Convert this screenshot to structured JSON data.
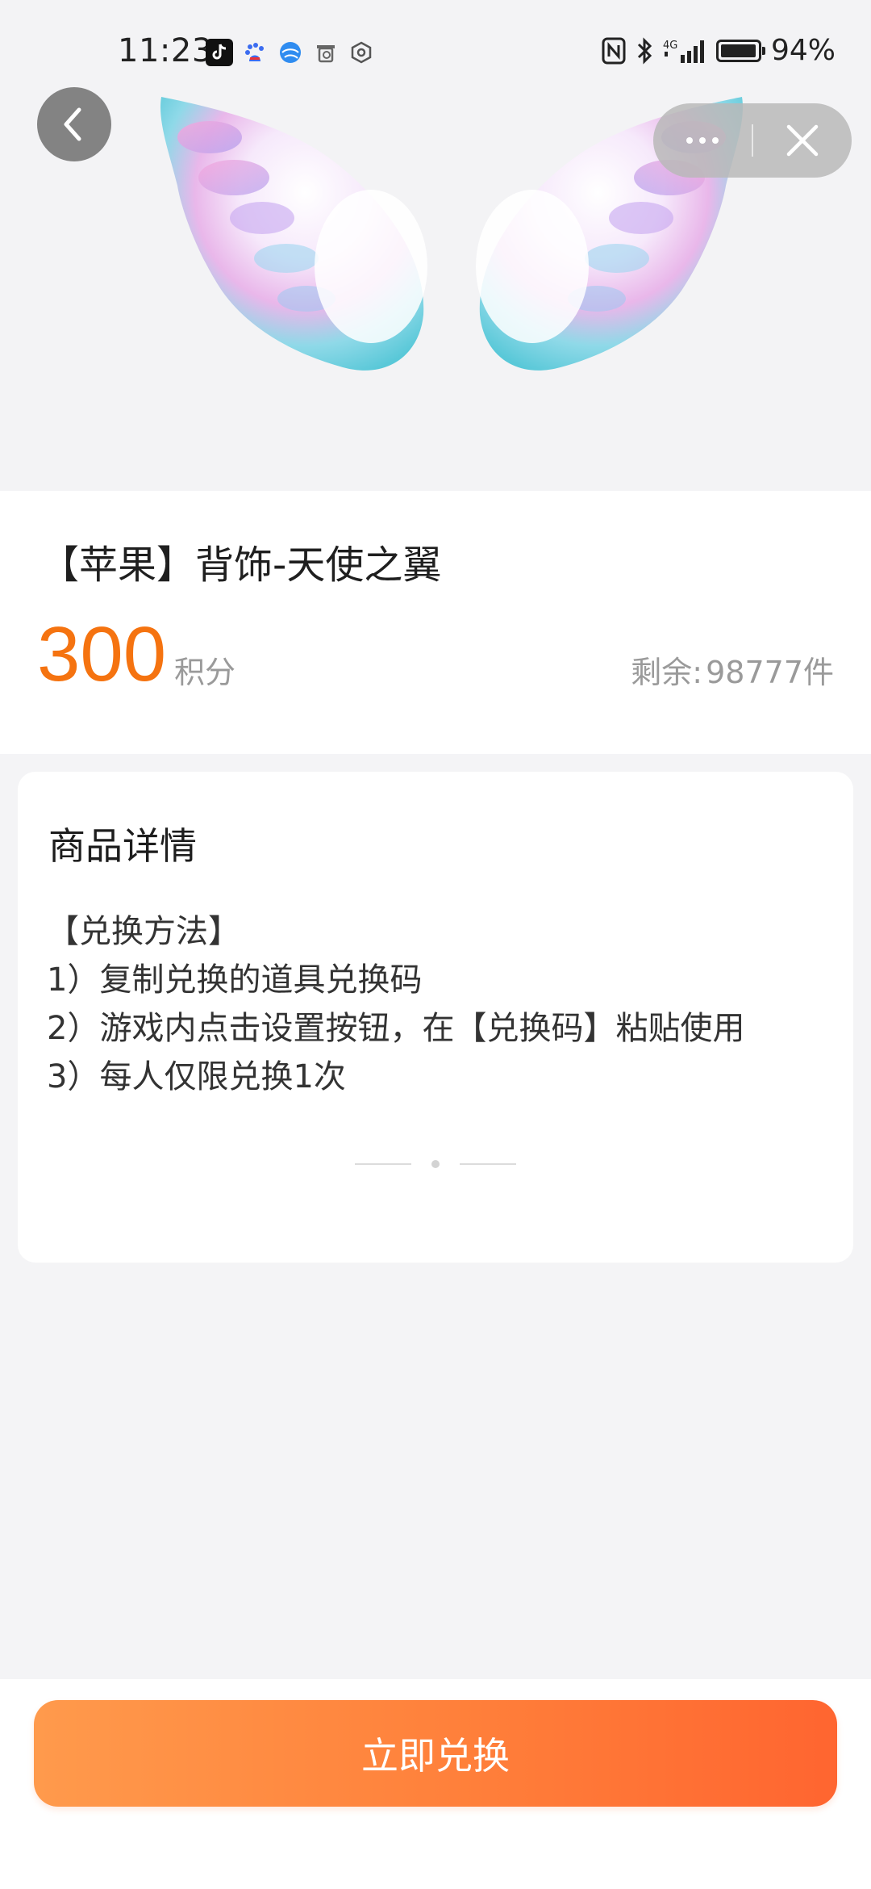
{
  "status_bar": {
    "time": "11:23",
    "battery": "94%",
    "network": "4G",
    "battery_level": 0.94
  },
  "nav": {
    "back_icon": "chevron-left-icon",
    "more_icon": "more-dots-icon",
    "close_icon": "close-icon"
  },
  "product": {
    "title": "【苹果】背饰-天使之翼",
    "price": "300",
    "price_unit": "积分",
    "stock_label": "剩余:",
    "stock_value": "98777件"
  },
  "details": {
    "heading": "商品详情",
    "lines": [
      "【兑换方法】",
      "1）复制兑换的道具兑换码",
      "2）游戏内点击设置按钮，在【兑换码】粘贴使用",
      "3）每人仅限兑换1次"
    ]
  },
  "action": {
    "exchange_label": "立即兑换"
  },
  "colors": {
    "accent": "#f57310",
    "button_start": "#ff9a4c",
    "button_end": "#ff6530"
  }
}
